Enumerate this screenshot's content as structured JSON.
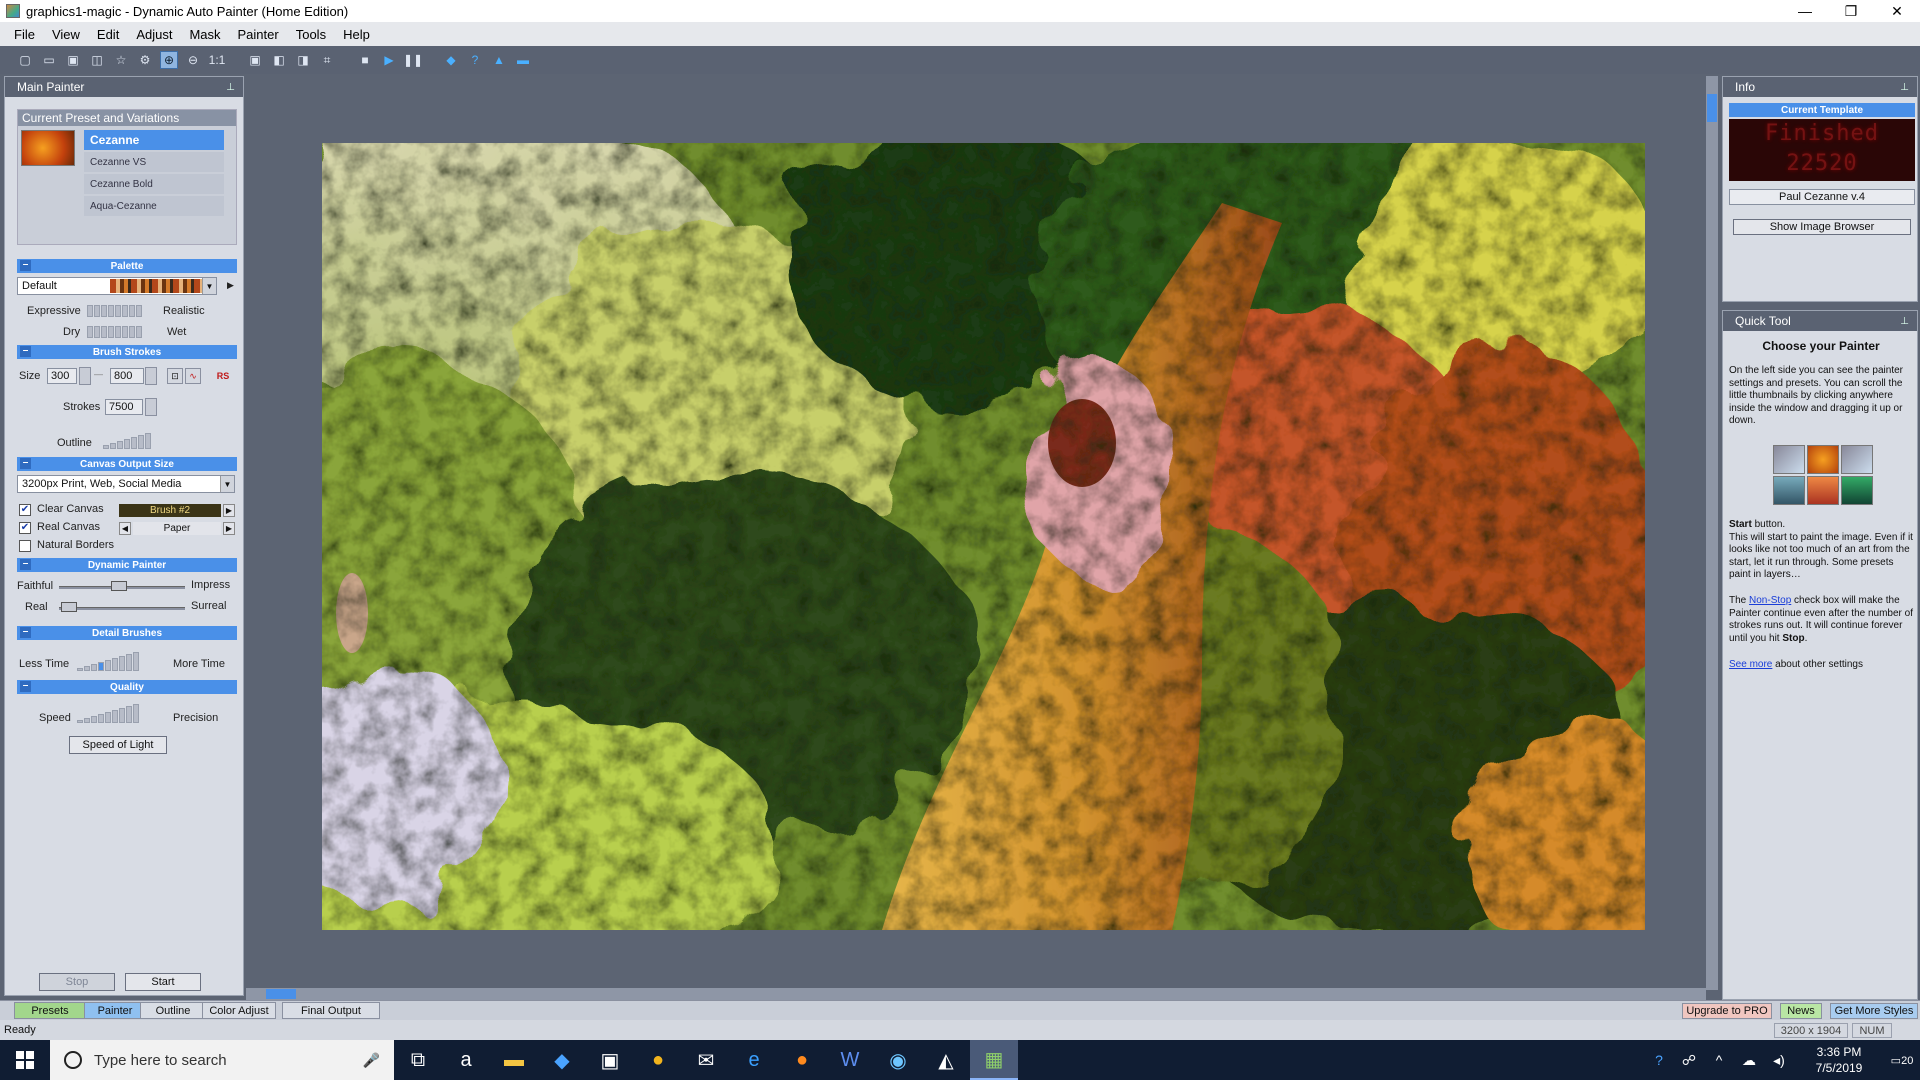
{
  "window": {
    "title": "graphics1-magic - Dynamic Auto Painter (Home Edition)",
    "controls": [
      "—",
      "❐",
      "✕"
    ]
  },
  "menu": [
    "File",
    "View",
    "Edit",
    "Adjust",
    "Mask",
    "Painter",
    "Tools",
    "Help"
  ],
  "toolbar": {
    "zoom_1to1": "1:1"
  },
  "main_painter": {
    "title": "Main Painter",
    "preset_section_title": "Current Preset and Variations",
    "presets": [
      "Cezanne",
      "Cezanne VS",
      "Cezanne Bold",
      "Aqua-Cezanne"
    ],
    "selected_preset": "Cezanne",
    "palette": {
      "section": "Palette",
      "value": "Default",
      "left_label_1": "Expressive",
      "right_label_1": "Realistic",
      "left_label_2": "Dry",
      "right_label_2": "Wet"
    },
    "brush_strokes": {
      "section": "Brush Strokes",
      "size_label": "Size",
      "size_min": "300",
      "size_max": "800",
      "size_dash": "—",
      "strokes_label": "Strokes",
      "strokes_value": "7500",
      "outline_label": "Outline",
      "rs_label": "RS"
    },
    "canvas_output": {
      "section": "Canvas Output Size",
      "value": "3200px Print, Web, Social Media",
      "clear_canvas_label": "Clear Canvas",
      "clear_canvas_checked": true,
      "clear_canvas_brush": "Brush #2",
      "real_canvas_label": "Real Canvas",
      "real_canvas_checked": true,
      "real_canvas_value": "Paper",
      "natural_borders_label": "Natural Borders",
      "natural_borders_checked": false
    },
    "dynamic_painter": {
      "section": "Dynamic Painter",
      "faithful": "Faithful",
      "impress": "Impress",
      "real": "Real",
      "surreal": "Surreal"
    },
    "detail_brushes": {
      "section": "Detail Brushes",
      "less": "Less Time",
      "more": "More Time"
    },
    "quality": {
      "section": "Quality",
      "speed": "Speed",
      "precision": "Precision",
      "button": "Speed of Light"
    },
    "stop_button": "Stop",
    "start_button": "Start"
  },
  "info": {
    "title": "Info",
    "current_template": "Current Template",
    "led_line1": "Finished",
    "led_line2": "22520",
    "template_name": "Paul Cezanne v.4",
    "show_image_browser": "Show Image Browser"
  },
  "quick_tool": {
    "title": "Quick Tool",
    "heading": "Choose your Painter",
    "intro": "On the left side you can see the painter settings and presets. You can scroll the little thumbnails by clicking anywhere inside the window and dragging it up or down.",
    "start_bold": "Start",
    "start_rest": " button.",
    "start_text": "This will start to paint the image. Even if it looks like not too much of an art from the start, let it run through. Some presets paint in layers…",
    "nonstop_pre": "The ",
    "nonstop_link": "Non-Stop",
    "nonstop_text": " check box will make the Painter continue even after the number of strokes runs out. It will continue forever until you hit ",
    "stop_bold": "Stop",
    "stop_end": ".",
    "see_more_link": "See more",
    "see_more_text": " about other settings"
  },
  "bottom_tabs": [
    "Presets",
    "Painter",
    "Outline",
    "Color Adjust",
    "Final Output"
  ],
  "right_tabs": {
    "upgrade": "Upgrade to PRO",
    "news": "News",
    "styles": "Get More Styles"
  },
  "status": {
    "text": "Ready",
    "dimensions": "3200 x 1904",
    "num": "NUM"
  },
  "taskbar": {
    "search_placeholder": "Type here to search",
    "time": "3:36 PM",
    "date": "7/5/2019",
    "notifications": "20"
  },
  "colors": {
    "accent_blue": "#4a90e8",
    "panel_bg": "#d8dce4",
    "workspace": "#5c6473",
    "led_red": "#ff2a2a"
  }
}
